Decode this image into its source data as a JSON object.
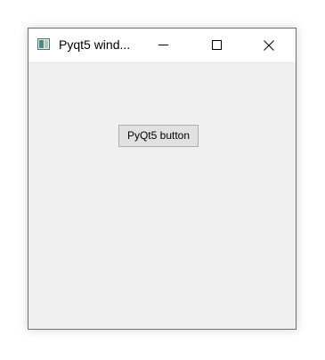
{
  "window": {
    "title": "Pyqt5 wind...",
    "controls": {
      "minimize_icon": "minimize-icon",
      "maximize_icon": "maximize-icon",
      "close_icon": "close-icon"
    }
  },
  "main": {
    "button_label": "PyQt5 button"
  },
  "colors": {
    "window_background": "#f0f0f0",
    "titlebar_background": "#ffffff",
    "button_background": "#e1e1e1",
    "button_border": "#adadad"
  }
}
